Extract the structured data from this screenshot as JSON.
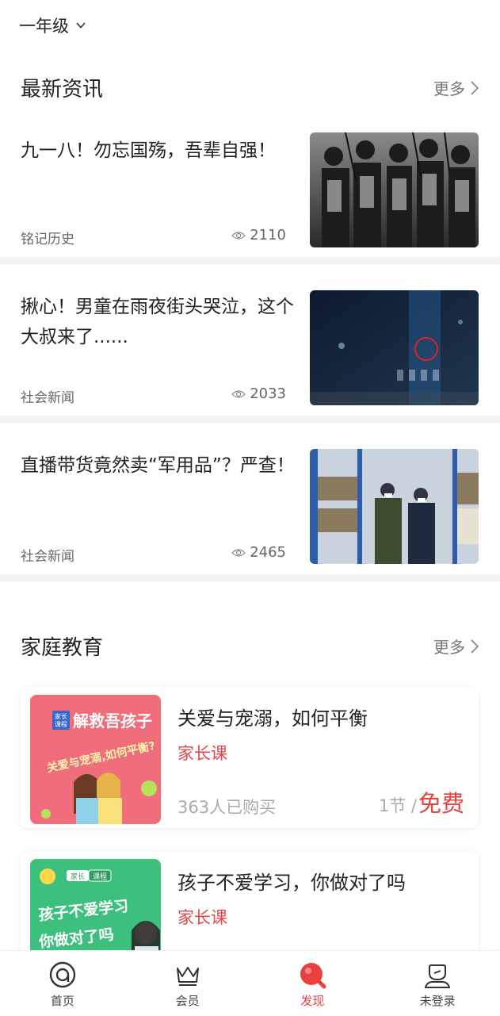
{
  "header": {
    "grade": "一年级"
  },
  "news_section": {
    "title": "最新资讯",
    "more": "更多",
    "items": [
      {
        "title": "九一八！勿忘国殇，吾辈自强！",
        "category": "铭记历史",
        "views": "2110"
      },
      {
        "title": "揪心！男童在雨夜街头哭泣，这个大叔来了......",
        "category": "社会新闻",
        "views": "2033"
      },
      {
        "title": "直播带货竟然卖“军用品”？严查！",
        "category": "社会新闻",
        "views": "2465"
      }
    ]
  },
  "edu_section": {
    "title": "家庭教育",
    "more": "更多",
    "courses": [
      {
        "title": "关爱与宠溺，如何平衡",
        "tag": "家长课",
        "buyers": "363人已购买",
        "lessons": "1节 /",
        "price": "免费",
        "thumb_badge": "家长课程",
        "thumb_heading": "解救吾孩子",
        "thumb_sub": "关爱与宠溺,如何平衡?"
      },
      {
        "title": "孩子不爱学习，你做对了吗",
        "tag": "家长课",
        "thumb_badge": "家长 课程",
        "thumb_heading": "孩子不爱学习",
        "thumb_sub": "你做对了吗"
      }
    ]
  },
  "bottom_nav": [
    {
      "label": "首页",
      "icon": "home-icon"
    },
    {
      "label": "会员",
      "icon": "crown-icon"
    },
    {
      "label": "发现",
      "icon": "discover-icon",
      "active": true
    },
    {
      "label": "未登录",
      "icon": "user-icon"
    }
  ],
  "colors": {
    "accent": "#e8413e",
    "tag_red": "#e0464a",
    "divider": "#f2f2f2"
  }
}
